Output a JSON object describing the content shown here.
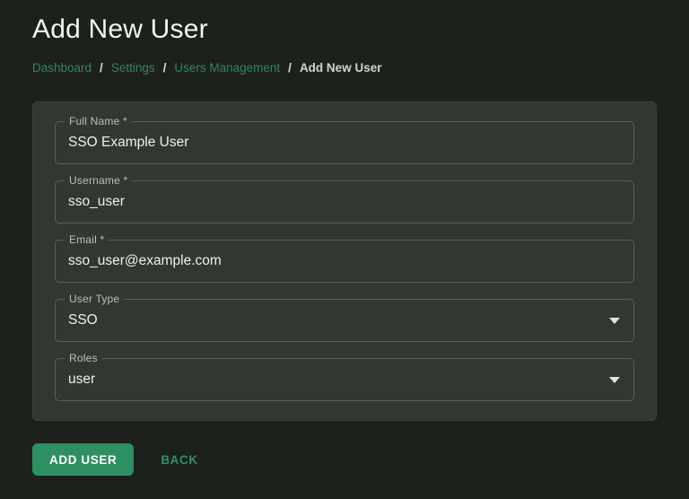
{
  "page": {
    "title": "Add New User"
  },
  "breadcrumb": {
    "separator": "/",
    "items": [
      {
        "label": "Dashboard"
      },
      {
        "label": "Settings"
      },
      {
        "label": "Users Management"
      },
      {
        "label": "Add New User"
      }
    ]
  },
  "form": {
    "fields": [
      {
        "label": "Full Name *",
        "value": "SSO Example User",
        "type": "text"
      },
      {
        "label": "Username *",
        "value": "sso_user",
        "type": "text"
      },
      {
        "label": "Email *",
        "value": "sso_user@example.com",
        "type": "text"
      },
      {
        "label": "User Type",
        "value": "SSO",
        "type": "select"
      },
      {
        "label": "Roles",
        "value": "user",
        "type": "select"
      }
    ]
  },
  "actions": {
    "submit_label": "ADD USER",
    "back_label": "BACK"
  },
  "colors": {
    "page_bg": "#1c211b",
    "card_bg": "#323731",
    "field_border": "#5a5f57",
    "accent_green": "#2e8f62",
    "breadcrumb_link_green": "#38835d"
  }
}
